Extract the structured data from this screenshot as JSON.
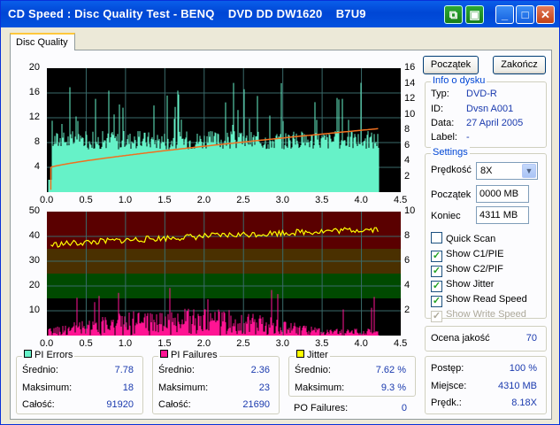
{
  "window": {
    "title": "CD Speed : Disc Quality Test - BENQ    DVD DD DW1620    B7U9",
    "minimize": "_",
    "maximize": "□",
    "close": "✕"
  },
  "tabs": [
    {
      "label": "Disc Quality"
    }
  ],
  "buttons": {
    "start": "Początek",
    "stop": "Zakończ"
  },
  "disc_info": {
    "title": "Info o dysku",
    "type_label": "Typ:",
    "type_value": "DVD-R",
    "id_label": "ID:",
    "id_value": "Dvsn A001",
    "date_label": "Data:",
    "date_value": "27 April 2005",
    "label_label": "Label:",
    "label_value": "-"
  },
  "settings": {
    "title": "Settings",
    "speed_label": "Prędkość",
    "speed_value": "8X",
    "start_label": "Początek",
    "start_value": "0000 MB",
    "end_label": "Koniec",
    "end_value": "4311 MB",
    "quick_scan": "Quick Scan",
    "show_c1": "Show C1/PIE",
    "show_c2": "Show C2/PIF",
    "show_jitter": "Show Jitter",
    "show_read": "Show Read Speed",
    "show_write": "Show Write Speed"
  },
  "quality": {
    "label": "Ocena jakość",
    "value": "70"
  },
  "progress": {
    "progress_label": "Postęp:",
    "progress_value": "100 %",
    "position_label": "Miejsce:",
    "position_value": "4310 MB",
    "speed_label": "Prędk.:",
    "speed_value": "8.18X"
  },
  "stats": {
    "pi_errors": {
      "title": "PI Errors",
      "color": "#66F2C8",
      "avg_label": "Średnio:",
      "avg": "7.78",
      "max_label": "Maksimum:",
      "max": "18",
      "total_label": "Całość:",
      "total": "91920"
    },
    "pi_failures": {
      "title": "PI Failures",
      "color": "#FF1493",
      "avg_label": "Średnio:",
      "avg": "2.36",
      "max_label": "Maksimum:",
      "max": "23",
      "total_label": "Całość:",
      "total": "21690"
    },
    "jitter": {
      "title": "Jitter",
      "color": "#FFFF00",
      "avg_label": "Średnio:",
      "avg": "7.62 %",
      "max_label": "Maksimum:",
      "max": "9.3 %",
      "po_label": "PO Failures:",
      "po": "0"
    }
  },
  "chart_data": [
    {
      "type": "area",
      "name": "PI Errors / Read Speed",
      "x_ticks": [
        "0.0",
        "0.5",
        "1.0",
        "1.5",
        "2.0",
        "2.5",
        "3.0",
        "3.5",
        "4.0",
        "4.5"
      ],
      "y_left_ticks": [
        "20",
        "16",
        "12",
        "8",
        "4"
      ],
      "y_right_ticks": [
        "16",
        "14",
        "12",
        "10",
        "8",
        "6",
        "4",
        "2"
      ],
      "xlim": [
        0,
        4.5
      ],
      "ylim": [
        0,
        20
      ],
      "y2lim": [
        0,
        16
      ],
      "series": [
        {
          "color": "#66F2C8",
          "baseline": 7.8,
          "max": 18
        },
        {
          "color": "#F07020",
          "x": [
            0.05,
            4.22
          ],
          "y2": [
            3.2,
            8.2
          ]
        }
      ]
    },
    {
      "type": "area",
      "name": "PI Failures / Jitter",
      "x_ticks": [
        "0.0",
        "0.5",
        "1.0",
        "1.5",
        "2.0",
        "2.5",
        "3.0",
        "3.5",
        "4.0",
        "4.5"
      ],
      "y_left_ticks": [
        "50",
        "40",
        "30",
        "20",
        "10"
      ],
      "y_right_ticks": [
        "10",
        "8",
        "6",
        "4",
        "2"
      ],
      "xlim": [
        0,
        4.5
      ],
      "ylim": [
        0,
        50
      ],
      "y2lim": [
        0,
        10
      ],
      "series": [
        {
          "color": "#FF1493",
          "baseline": 2.4,
          "max": 23
        },
        {
          "color": "#FFFF00",
          "x": [
            0.05,
            4.22
          ],
          "y2": [
            7.3,
            8.6
          ]
        }
      ]
    }
  ]
}
